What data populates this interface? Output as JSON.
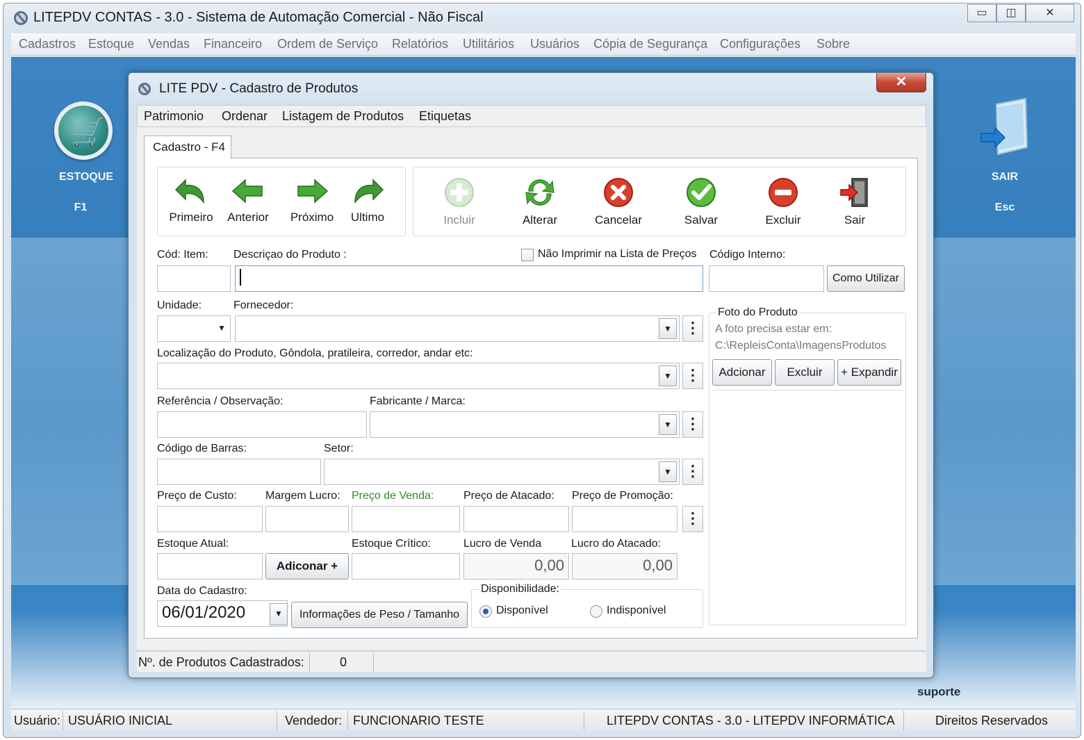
{
  "window": {
    "title": "LITEPDV CONTAS - 3.0 - Sistema de Automação Comercial - Não Fiscal",
    "minimize": "▭",
    "maximize": "◫",
    "close": "✕"
  },
  "menubar": [
    "Cadastros",
    "Estoque",
    "Vendas",
    "Financeiro",
    "Ordem de Serviço",
    "Relatórios",
    "Utilitários",
    "Usuários",
    "Cópia de Segurança",
    "Configurações",
    "Sobre"
  ],
  "desktop": {
    "left_label": "ESTOQUE",
    "left_shortcut": "F1",
    "right_label": "SAIR",
    "right_shortcut": "Esc",
    "support": "suporte"
  },
  "statusbar": {
    "user_label": "Usuário:",
    "user_value": "USUÁRIO INICIAL",
    "seller_label": "Vendedor:",
    "seller_value": "FUNCIONARIO TESTE",
    "product": "LITEPDV CONTAS - 3.0 - LITEPDV INFORMÁTICA",
    "rights": "Direitos Reservados"
  },
  "dialog": {
    "title": "LITE PDV - Cadastro de Produtos",
    "close": "✕",
    "menu": [
      "Patrimonio",
      "Ordenar",
      "Listagem de Produtos",
      "Etiquetas"
    ],
    "tab": "Cadastro - F4",
    "nav": [
      "Primeiro",
      "Anterior",
      "Próximo",
      "Ultimo"
    ],
    "actions": [
      "Incluir",
      "Alterar",
      "Cancelar",
      "Salvar",
      "Excluir",
      "Sair"
    ],
    "labels": {
      "cod_item": "Cód: Item:",
      "descricao": "Descriçao do Produto :",
      "nao_imprimir": "Não Imprimir  na Lista de Preços",
      "codigo_interno": "Código Interno:",
      "como_utilizar": "Como Utilizar",
      "unidade": "Unidade:",
      "fornecedor": "Fornecedor:",
      "localizacao": "Localização do Produto, Gôndola, pratileira, corredor, andar etc:",
      "referencia": "Referência / Observação:",
      "fabricante": "Fabricante / Marca:",
      "codigo_barras": "Código de Barras:",
      "setor": "Setor:",
      "preco_custo": "Preço de Custo:",
      "margem_lucro": "Margem Lucro:",
      "preco_venda": "Preço de Venda:",
      "preco_atacado": "Preço de Atacado:",
      "preco_promocao": "Preço de Promoção:",
      "estoque_atual": "Estoque Atual:",
      "adicionar": "Adiconar +",
      "estoque_critico": "Estoque Crítico:",
      "lucro_venda": "Lucro de Venda",
      "lucro_atacado": "Lucro do Atacado:",
      "data_cadastro": "Data do Cadastro:",
      "info_peso": "Informações de Peso / Tamanho",
      "disponibilidade": "Disponibilidade:",
      "disponivel": "Disponível",
      "indisponivel": "Indisponível"
    },
    "values": {
      "lucro_venda": "0,00",
      "lucro_atacado": "0,00",
      "data_cadastro": "06/01/2020",
      "disponibilidade": "Disponível"
    },
    "foto": {
      "title": "Foto do Produto",
      "hint": "A foto precisa estar em:",
      "path": "C:\\RepleisConta\\ImagensProdutos",
      "buttons": [
        "Adcionar",
        "Excluir",
        "+ Expandir"
      ]
    },
    "status": {
      "label": "Nº. de Produtos Cadastrados:",
      "count": "0"
    }
  }
}
